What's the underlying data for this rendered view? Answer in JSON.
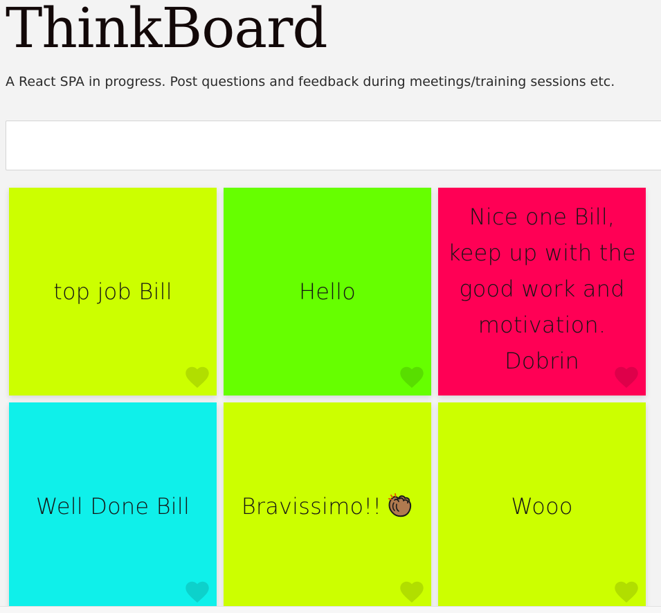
{
  "header": {
    "title": "ThinkBoard",
    "subtitle": "A React SPA in progress. Post questions and feedback during meetings/training sessions etc."
  },
  "post_input": {
    "value": "",
    "placeholder": ""
  },
  "notes": [
    {
      "text": "top job Bill",
      "color": "#ccff00",
      "heart_icon": "heart-icon"
    },
    {
      "text": "Hello",
      "color": "#66ff00",
      "heart_icon": "heart-icon"
    },
    {
      "text": "Nice one Bill, keep up with the good work and motivation. Dobrin",
      "color": "#ff0055",
      "heart_icon": "heart-icon"
    },
    {
      "text": "Well Done Bill",
      "color": "#0ff0ea",
      "heart_icon": "heart-icon"
    },
    {
      "text": "Bravissimo!!",
      "emoji": "clapping-hands-icon",
      "color": "#ccff00",
      "heart_icon": "heart-icon"
    },
    {
      "text": "Wooo",
      "color": "#ccff00",
      "heart_icon": "heart-icon"
    }
  ]
}
